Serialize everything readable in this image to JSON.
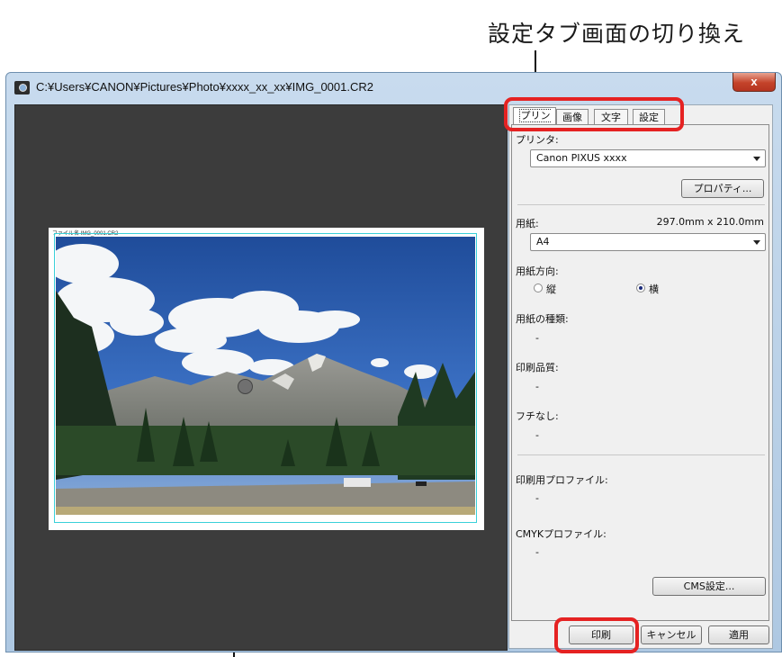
{
  "callout": {
    "tab_switch": "設定タブ画面の切り換え"
  },
  "window": {
    "title": "C:¥Users¥CANON¥Pictures¥Photo¥xxxx_xx_xx¥IMG_0001.CR2",
    "close_label": "x"
  },
  "preview": {
    "paper_label": "ファイル名  IMG_0001.CR2"
  },
  "tabs": [
    "プリンタ",
    "画像",
    "文字",
    "設定"
  ],
  "printer": {
    "label": "プリンタ:",
    "selected": "Canon PIXUS xxxx",
    "properties_button": "プロパティ..."
  },
  "paper": {
    "label": "用紙:",
    "size_value": "297.0mm x 210.0mm",
    "selected": "A4",
    "orientation_label": "用紙方向:",
    "portrait": "縦",
    "landscape": "横",
    "orientation_selected": "landscape",
    "type_label": "用紙の種類:",
    "type_value": "-",
    "quality_label": "印刷品質:",
    "quality_value": "-",
    "borderless_label": "フチなし:",
    "borderless_value": "-"
  },
  "profiles": {
    "print_profile_label": "印刷用プロファイル:",
    "print_profile_value": "-",
    "cmyk_profile_label": "CMYKプロファイル:",
    "cmyk_profile_value": "-",
    "cms_button": "CMS設定..."
  },
  "actions": {
    "print": "印刷",
    "cancel": "キャンセル",
    "apply": "適用"
  },
  "colors": {
    "highlight": "#e52222",
    "guide_frame": "#39d0d9"
  }
}
